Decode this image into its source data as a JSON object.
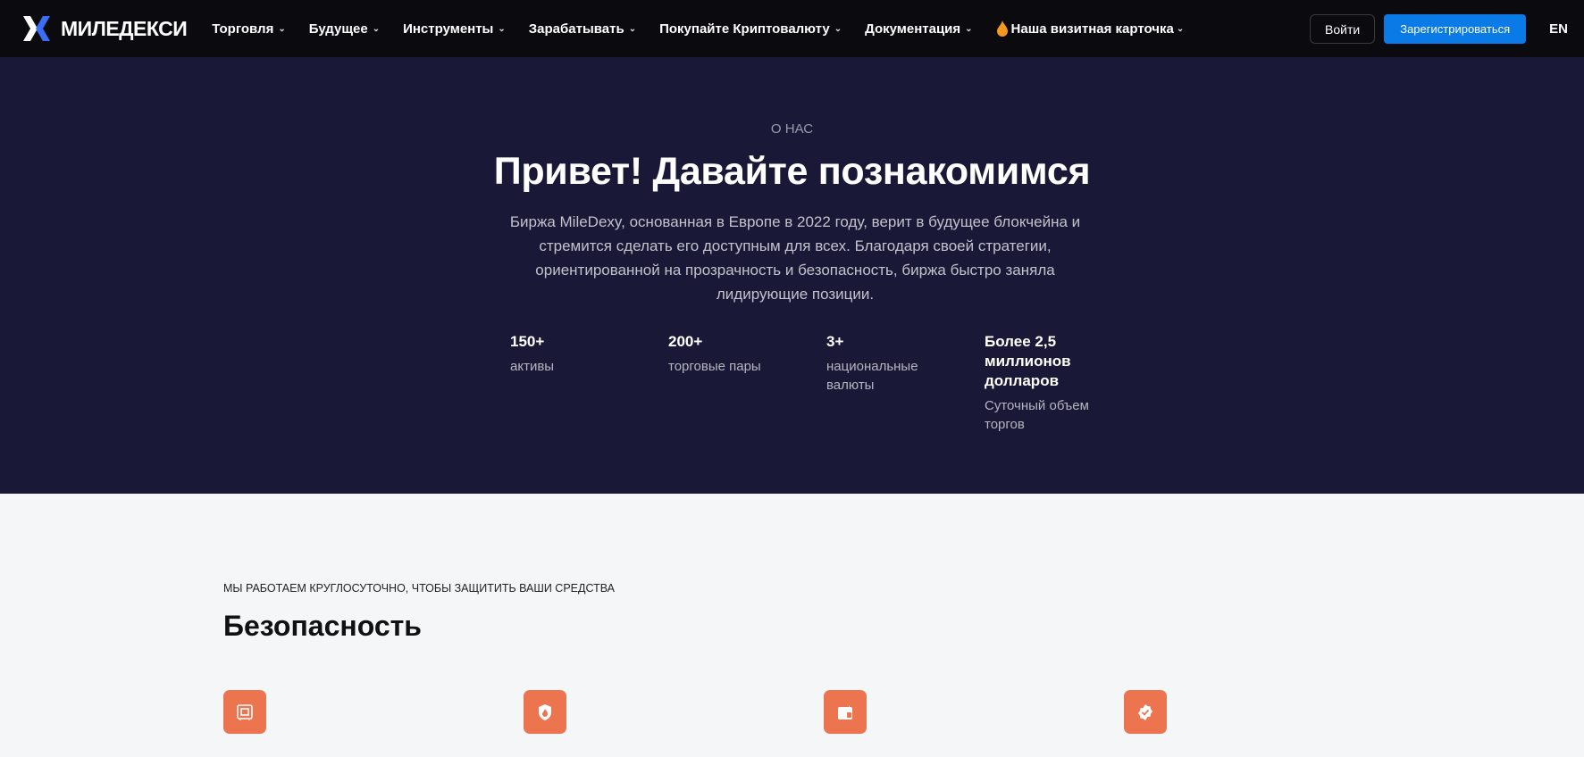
{
  "nav": {
    "brand": "МИЛЕДЕКСИ",
    "items": [
      {
        "label": "Торговля"
      },
      {
        "label": "Будущее"
      },
      {
        "label": "Инструменты"
      },
      {
        "label": "Зарабатывать"
      },
      {
        "label": "Покупайте Криптовалюту"
      },
      {
        "label": "Документация"
      },
      {
        "label": "Наша визитная карточка",
        "icon": "fire-icon"
      }
    ],
    "login": "Войти",
    "register": "Зарегистрироваться",
    "lang": "EN"
  },
  "hero": {
    "eyebrow": "О НАС",
    "title": "Привет! Давайте познакомимся",
    "description": "Биржа MileDexy, основанная в Европе в 2022 году, верит в будущее блокчейна и стремится сделать его доступным для всех. Благодаря своей стратегии, ориентированной на прозрачность и безопасность, биржа быстро заняла лидирующие позиции.",
    "stats": [
      {
        "value": "150+",
        "label": "активы"
      },
      {
        "value": "200+",
        "label": "торговые пары"
      },
      {
        "value": "3+",
        "label": "национальные валюты"
      },
      {
        "value": "Более 2,5 миллионов долларов",
        "label": "Суточный объем торгов"
      }
    ]
  },
  "security": {
    "eyebrow": "МЫ РАБОТАЕМ КРУГЛОСУТОЧНО, ЧТОБЫ ЗАЩИТИТЬ ВАШИ СРЕДСТВА",
    "title": "Безопасность",
    "icons": [
      "safe-icon",
      "shield-fire-icon",
      "wallet-icon",
      "verified-badge-icon"
    ],
    "accent": "#ec7550"
  }
}
